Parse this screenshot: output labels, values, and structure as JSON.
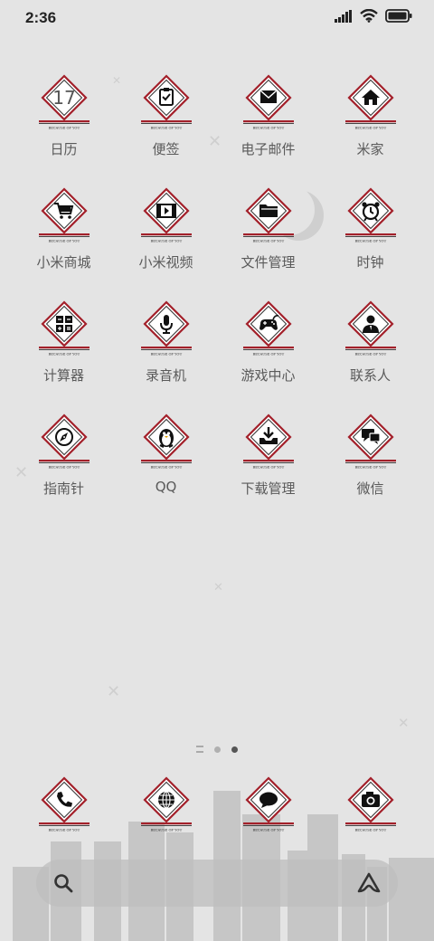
{
  "status_bar": {
    "time": "2:36"
  },
  "badge_text": "BECAUSE OF YOU",
  "apps": [
    {
      "label": "日历",
      "icon": "calendar-icon",
      "day": "17"
    },
    {
      "label": "便签",
      "icon": "notes-icon"
    },
    {
      "label": "电子邮件",
      "icon": "mail-icon"
    },
    {
      "label": "米家",
      "icon": "home-icon"
    },
    {
      "label": "小米商城",
      "icon": "shopping-cart-icon"
    },
    {
      "label": "小米视频",
      "icon": "video-icon"
    },
    {
      "label": "文件管理",
      "icon": "folder-icon"
    },
    {
      "label": "时钟",
      "icon": "alarm-clock-icon"
    },
    {
      "label": "计算器",
      "icon": "calculator-icon"
    },
    {
      "label": "录音机",
      "icon": "microphone-icon"
    },
    {
      "label": "游戏中心",
      "icon": "gamepad-icon"
    },
    {
      "label": "联系人",
      "icon": "contact-icon"
    },
    {
      "label": "指南针",
      "icon": "compass-icon"
    },
    {
      "label": "QQ",
      "icon": "penguin-icon"
    },
    {
      "label": "下载管理",
      "icon": "download-icon"
    },
    {
      "label": "微信",
      "icon": "chat-bubbles-icon"
    }
  ],
  "dock": [
    {
      "icon": "phone-icon"
    },
    {
      "icon": "globe-icon"
    },
    {
      "icon": "message-icon"
    },
    {
      "icon": "camera-icon"
    }
  ],
  "page_indicator": {
    "pages": 3,
    "active": 2
  },
  "colors": {
    "accent_red": "#a3202a",
    "icon_black": "#111111"
  }
}
